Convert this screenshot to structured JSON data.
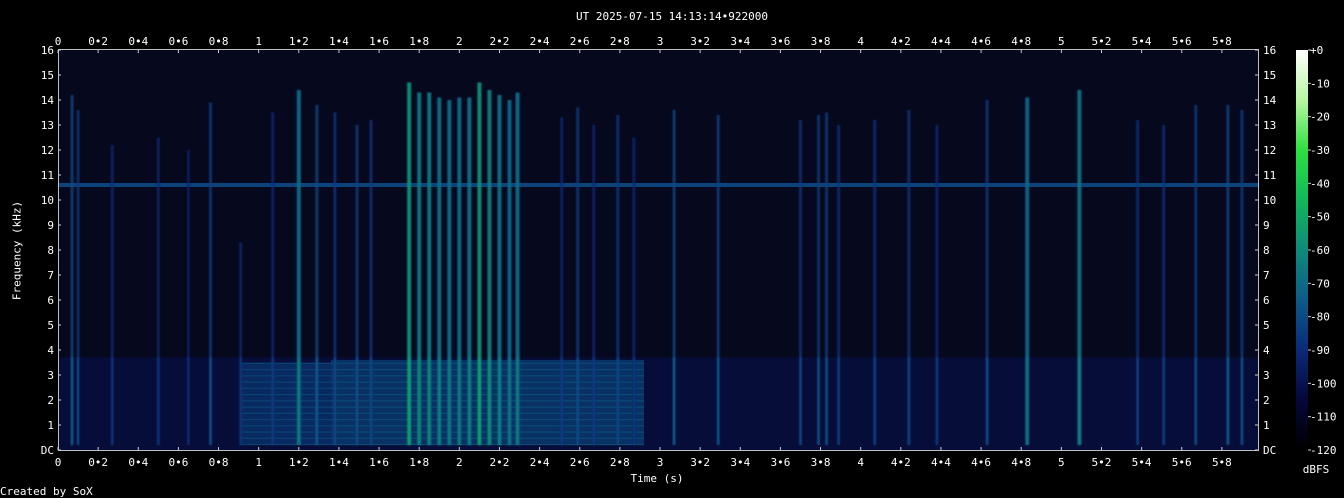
{
  "chart_data": {
    "type": "heatmap",
    "title": "UT 2025-07-15 14:13:14•922000",
    "xlabel": "Time (s)",
    "ylabel": "Frequency (kHz)",
    "credit": "Created by SoX",
    "x_range": [
      0,
      5.98
    ],
    "y_range": [
      0,
      16
    ],
    "x_ticks": [
      {
        "v": 0,
        "t": "0"
      },
      {
        "v": 0.2,
        "t": "0•2"
      },
      {
        "v": 0.4,
        "t": "0•4"
      },
      {
        "v": 0.6,
        "t": "0•6"
      },
      {
        "v": 0.8,
        "t": "0•8"
      },
      {
        "v": 1,
        "t": "1"
      },
      {
        "v": 1.2,
        "t": "1•2"
      },
      {
        "v": 1.4,
        "t": "1•4"
      },
      {
        "v": 1.6,
        "t": "1•6"
      },
      {
        "v": 1.8,
        "t": "1•8"
      },
      {
        "v": 2,
        "t": "2"
      },
      {
        "v": 2.2,
        "t": "2•2"
      },
      {
        "v": 2.4,
        "t": "2•4"
      },
      {
        "v": 2.6,
        "t": "2•6"
      },
      {
        "v": 2.8,
        "t": "2•8"
      },
      {
        "v": 3,
        "t": "3"
      },
      {
        "v": 3.2,
        "t": "3•2"
      },
      {
        "v": 3.4,
        "t": "3•4"
      },
      {
        "v": 3.6,
        "t": "3•6"
      },
      {
        "v": 3.8,
        "t": "3•8"
      },
      {
        "v": 4,
        "t": "4"
      },
      {
        "v": 4.2,
        "t": "4•2"
      },
      {
        "v": 4.4,
        "t": "4•4"
      },
      {
        "v": 4.6,
        "t": "4•6"
      },
      {
        "v": 4.8,
        "t": "4•8"
      },
      {
        "v": 5,
        "t": "5"
      },
      {
        "v": 5.2,
        "t": "5•2"
      },
      {
        "v": 5.4,
        "t": "5•4"
      },
      {
        "v": 5.6,
        "t": "5•6"
      },
      {
        "v": 5.8,
        "t": "5•8"
      }
    ],
    "y_ticks": [
      {
        "v": 0,
        "t": "DC"
      },
      {
        "v": 1,
        "t": "1"
      },
      {
        "v": 2,
        "t": "2"
      },
      {
        "v": 3,
        "t": "3"
      },
      {
        "v": 4,
        "t": "4"
      },
      {
        "v": 5,
        "t": "5"
      },
      {
        "v": 6,
        "t": "6"
      },
      {
        "v": 7,
        "t": "7"
      },
      {
        "v": 8,
        "t": "8"
      },
      {
        "v": 9,
        "t": "9"
      },
      {
        "v": 10,
        "t": "10"
      },
      {
        "v": 11,
        "t": "11"
      },
      {
        "v": 12,
        "t": "12"
      },
      {
        "v": 13,
        "t": "13"
      },
      {
        "v": 14,
        "t": "14"
      },
      {
        "v": 15,
        "t": "15"
      },
      {
        "v": 16,
        "t": "16"
      }
    ],
    "colorbar": {
      "unit": "dBFS",
      "range": [
        -120,
        0
      ],
      "ticks": [
        {
          "v": 0,
          "t": "+0"
        },
        {
          "v": -10,
          "t": "-10"
        },
        {
          "v": -20,
          "t": "-20"
        },
        {
          "v": -30,
          "t": "-30"
        },
        {
          "v": -40,
          "t": "-40"
        },
        {
          "v": -50,
          "t": "-50"
        },
        {
          "v": -60,
          "t": "-60"
        },
        {
          "v": -70,
          "t": "-70"
        },
        {
          "v": -80,
          "t": "-80"
        },
        {
          "v": -90,
          "t": "-90"
        },
        {
          "v": -100,
          "t": "-100"
        },
        {
          "v": -110,
          "t": "-110"
        },
        {
          "v": -120,
          "t": "-120"
        }
      ],
      "colors": [
        "#000000",
        "#06063a",
        "#0a2a78",
        "#0d5a8a",
        "#0f8a7a",
        "#11b85a",
        "#2ee040",
        "#b8f7a0",
        "#ffffff"
      ]
    },
    "background_color": "#06081e",
    "tone_line": {
      "freq_khz": 10.6,
      "level_dbfs": -80
    },
    "noise_floor_khz": [
      0,
      3.7
    ],
    "noise_patches": [
      {
        "t0": 0.91,
        "t1": 1.36,
        "f0": 0.2,
        "f1": 3.5,
        "level_dbfs": -82
      },
      {
        "t0": 1.36,
        "t1": 2.92,
        "f0": 0.2,
        "f1": 3.6,
        "level_dbfs": -78
      }
    ],
    "transients": [
      {
        "t": 0.07,
        "f_max": 14.2,
        "level_dbfs": -80
      },
      {
        "t": 0.1,
        "f_max": 13.6,
        "level_dbfs": -86
      },
      {
        "t": 0.27,
        "f_max": 12.2,
        "level_dbfs": -92
      },
      {
        "t": 0.5,
        "f_max": 12.5,
        "level_dbfs": -92
      },
      {
        "t": 0.65,
        "f_max": 12,
        "level_dbfs": -94
      },
      {
        "t": 0.76,
        "f_max": 13.9,
        "level_dbfs": -84
      },
      {
        "t": 0.91,
        "f_max": 8.3,
        "level_dbfs": -92
      },
      {
        "t": 1.07,
        "f_max": 13.5,
        "level_dbfs": -90
      },
      {
        "t": 1.2,
        "f_max": 14.4,
        "level_dbfs": -70
      },
      {
        "t": 1.29,
        "f_max": 13.8,
        "level_dbfs": -80
      },
      {
        "t": 1.38,
        "f_max": 13.5,
        "level_dbfs": -86
      },
      {
        "t": 1.49,
        "f_max": 13,
        "level_dbfs": -84
      },
      {
        "t": 1.56,
        "f_max": 13.2,
        "level_dbfs": -86
      },
      {
        "t": 1.75,
        "f_max": 14.7,
        "level_dbfs": -58
      },
      {
        "t": 1.8,
        "f_max": 14.3,
        "level_dbfs": -66
      },
      {
        "t": 1.85,
        "f_max": 14.3,
        "level_dbfs": -66
      },
      {
        "t": 1.9,
        "f_max": 14.1,
        "level_dbfs": -68
      },
      {
        "t": 1.95,
        "f_max": 14,
        "level_dbfs": -70
      },
      {
        "t": 2,
        "f_max": 14.1,
        "level_dbfs": -70
      },
      {
        "t": 2.05,
        "f_max": 14.1,
        "level_dbfs": -68
      },
      {
        "t": 2.1,
        "f_max": 14.7,
        "level_dbfs": -58
      },
      {
        "t": 2.15,
        "f_max": 14.4,
        "level_dbfs": -64
      },
      {
        "t": 2.2,
        "f_max": 14.2,
        "level_dbfs": -68
      },
      {
        "t": 2.25,
        "f_max": 14,
        "level_dbfs": -72
      },
      {
        "t": 2.29,
        "f_max": 14.3,
        "level_dbfs": -70
      },
      {
        "t": 2.51,
        "f_max": 13.3,
        "level_dbfs": -90
      },
      {
        "t": 2.59,
        "f_max": 13.7,
        "level_dbfs": -84
      },
      {
        "t": 2.67,
        "f_max": 13,
        "level_dbfs": -90
      },
      {
        "t": 2.79,
        "f_max": 13.4,
        "level_dbfs": -86
      },
      {
        "t": 2.87,
        "f_max": 12.5,
        "level_dbfs": -92
      },
      {
        "t": 3.07,
        "f_max": 13.6,
        "level_dbfs": -80
      },
      {
        "t": 3.29,
        "f_max": 13.4,
        "level_dbfs": -82
      },
      {
        "t": 3.7,
        "f_max": 13.2,
        "level_dbfs": -86
      },
      {
        "t": 3.79,
        "f_max": 13.4,
        "level_dbfs": -84
      },
      {
        "t": 3.83,
        "f_max": 13.5,
        "level_dbfs": -84
      },
      {
        "t": 3.89,
        "f_max": 13,
        "level_dbfs": -88
      },
      {
        "t": 4.07,
        "f_max": 13.2,
        "level_dbfs": -88
      },
      {
        "t": 4.24,
        "f_max": 13.6,
        "level_dbfs": -86
      },
      {
        "t": 4.38,
        "f_max": 13,
        "level_dbfs": -90
      },
      {
        "t": 4.63,
        "f_max": 14,
        "level_dbfs": -84
      },
      {
        "t": 4.83,
        "f_max": 14.1,
        "level_dbfs": -72
      },
      {
        "t": 5.09,
        "f_max": 14.4,
        "level_dbfs": -68
      },
      {
        "t": 5.38,
        "f_max": 13.2,
        "level_dbfs": -88
      },
      {
        "t": 5.51,
        "f_max": 13,
        "level_dbfs": -88
      },
      {
        "t": 5.67,
        "f_max": 13.8,
        "level_dbfs": -84
      },
      {
        "t": 5.83,
        "f_max": 13.8,
        "level_dbfs": -80
      },
      {
        "t": 5.9,
        "f_max": 13.6,
        "level_dbfs": -84
      }
    ]
  }
}
